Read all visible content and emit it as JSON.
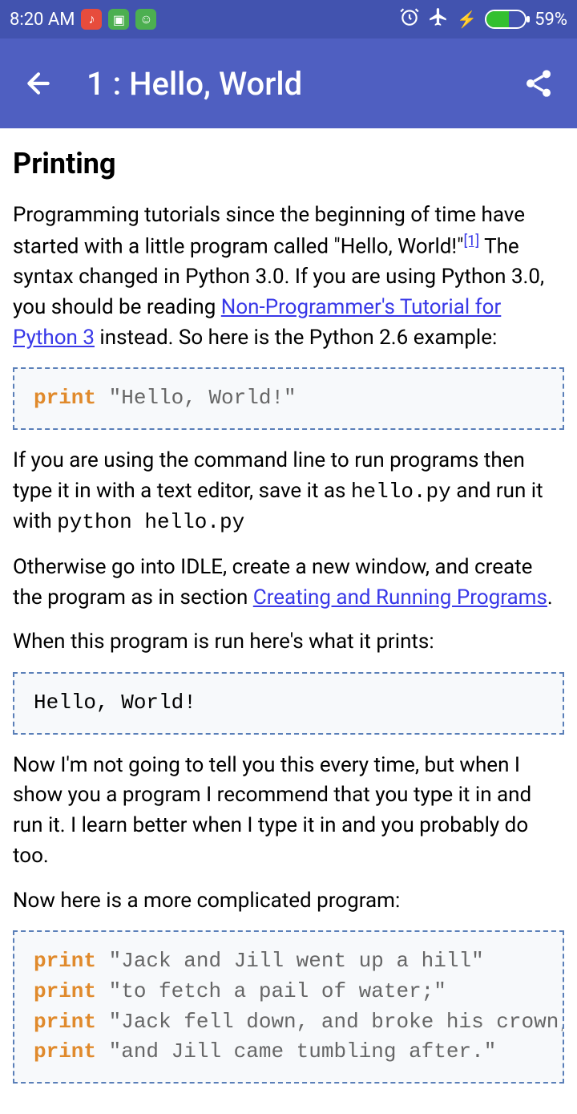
{
  "status": {
    "time": "8:20 AM",
    "battery_pct": "59%"
  },
  "appbar": {
    "title": "1 : Hello, World"
  },
  "content": {
    "heading": "Printing",
    "p1_a": "Programming tutorials since the beginning of time have started with a little program called \"Hello, World!\"",
    "p1_sup": "[1]",
    "p1_b": " The syntax changed in Python 3.0. If you are using Python 3.0, you should be reading ",
    "p1_link": "Non-Programmer's Tutorial for Python 3",
    "p1_c": " instead. So here is the Python 2.6 example:",
    "code1_kw": "print",
    "code1_str": " \"Hello, World!\"",
    "p2_a": "If you are using the command line to run programs then type it in with a text editor, save it as ",
    "p2_mono1": "hello.py",
    "p2_b": " and run it with ",
    "p2_mono2": "python hello.py",
    "p3_a": "Otherwise go into IDLE, create a new window, and create the program as in section ",
    "p3_link": "Creating and Running Programs",
    "p3_b": ".",
    "p4": "When this program is run here's what it prints:",
    "code2": "Hello, World!",
    "p5": "Now I'm not going to tell you this every time, but when I show you a program I recommend that you type it in and run it. I learn better when I type it in and you probably do too.",
    "p6": "Now here is a more complicated program:",
    "code3_kw": "print",
    "code3_l1": " \"Jack and Jill went up a hill\"",
    "code3_l2": " \"to fetch a pail of water;\"",
    "code3_l3": " \"Jack fell down, and broke his crown,\"",
    "code3_l4": " \"and Jill came tumbling after.\""
  }
}
